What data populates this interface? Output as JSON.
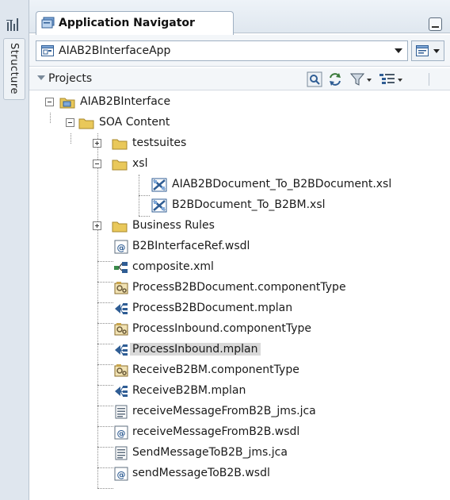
{
  "side_panel": {
    "tab_label": "Structure",
    "icon": "structure-icon"
  },
  "navigator": {
    "tab_title": "Application Navigator",
    "application": "AIAB2BInterfaceApp",
    "section_label": "Projects"
  },
  "tree": {
    "project": "AIAB2BInterface",
    "soa_content": "SOA Content",
    "testsuites": "testsuites",
    "xsl": "xsl",
    "xsl_file_1": "AIAB2BDocument_To_B2BDocument.xsl",
    "xsl_file_2": "B2BDocument_To_B2BM.xsl",
    "business_rules": "Business Rules",
    "items": [
      {
        "label": "B2BInterfaceRef.wsdl",
        "icon": "wsdl-icon"
      },
      {
        "label": "composite.xml",
        "icon": "composite-icon"
      },
      {
        "label": "ProcessB2BDocument.componentType",
        "icon": "component-type-icon"
      },
      {
        "label": "ProcessB2BDocument.mplan",
        "icon": "mplan-icon"
      },
      {
        "label": "ProcessInbound.componentType",
        "icon": "component-type-icon"
      },
      {
        "label": "ProcessInbound.mplan",
        "icon": "mplan-icon",
        "selected": true
      },
      {
        "label": "ReceiveB2BM.componentType",
        "icon": "component-type-icon"
      },
      {
        "label": "ReceiveB2BM.mplan",
        "icon": "mplan-icon"
      },
      {
        "label": "receiveMessageFromB2B_jms.jca",
        "icon": "jca-file-icon"
      },
      {
        "label": "receiveMessageFromB2B.wsdl",
        "icon": "wsdl-icon"
      },
      {
        "label": "SendMessageToB2B_jms.jca",
        "icon": "jca-file-icon"
      },
      {
        "label": "sendMessageToB2B.wsdl",
        "icon": "wsdl-icon"
      }
    ]
  },
  "colors": {
    "folder": "#e9c85a",
    "selection": "#d9d9d9",
    "panel_border": "#9fb0c2"
  }
}
